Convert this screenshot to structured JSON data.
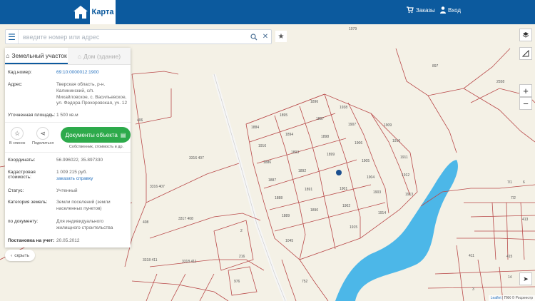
{
  "header": {
    "map_tab": "Карта",
    "orders_label": "Заказы",
    "login_label": "Вход"
  },
  "search": {
    "placeholder": "введите номер или адрес"
  },
  "panel": {
    "tabs": [
      "Земельный участок",
      "Дом (здание)"
    ],
    "fields": {
      "cad_number_label": "Кад.номер:",
      "cad_number_value": "69:10:0000012:1900",
      "address_label": "Адрес:",
      "address_value": "Тверская область, р-н. Калининский, с/п. Михайловское, с. Васильевское, ул. Федора Прохоровская, уч. 12",
      "area_label": "Уточненная площадь:",
      "area_value": "1 500 кв.м"
    },
    "actions": {
      "save_label": "В список",
      "share_label": "Поделиться",
      "docs_label": "Документы объекта",
      "docs_sub": "Собственник, стоимость и др."
    },
    "details": {
      "coords_label": "Координаты:",
      "coords_value": "56.996022, 35.897330",
      "cost_label": "Кадастровая стоимость:",
      "cost_value": "1 009 215 руб.",
      "cost_link": "заказать справку",
      "status_label": "Статус:",
      "status_value": "Учтенный",
      "category_label": "Категория земель:",
      "category_value": "Земли поселений (земли населенных пунктов)",
      "doc_label": "по документу:",
      "doc_value": "Для индивидуального жилищного строительства",
      "registered_label": "Постановка на учет:",
      "registered_value": "20.05.2012"
    },
    "hide_label": "скрыть"
  },
  "map": {
    "attribution_link": "Leaflet",
    "attribution_text": " | ПКК © Росреестр",
    "parcel_labels": [
      "1079",
      "897",
      "2558",
      "406",
      "1896",
      "1938",
      "1895",
      "1897",
      "1884",
      "1907",
      "1909",
      "1898",
      "1894",
      "1916",
      "1910",
      "1899",
      "1893",
      "1906",
      "1911",
      "1886",
      "1892",
      "1905",
      "1887",
      "1891",
      "1904",
      "1912",
      "1901",
      "1903",
      "1913",
      "1888",
      "1902",
      "1890",
      "1914",
      "1889",
      "1915",
      "3316 407",
      "3316 407",
      "3317 408",
      "408",
      "2",
      "1045",
      "216",
      "3318 411",
      "3318 411",
      "976",
      "752",
      "7/1",
      "6",
      "7/2",
      "413",
      "411",
      "415",
      "14",
      "3"
    ],
    "accent_parcel": "#b94a4a",
    "water_color": "#4cb7e8"
  }
}
